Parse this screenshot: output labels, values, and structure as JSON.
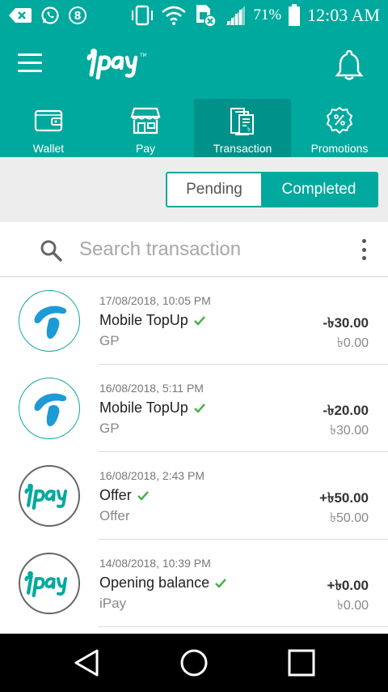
{
  "status_bar": {
    "battery_percent": "71%",
    "time": "12:03 AM"
  },
  "app": {
    "logo_text": "ipay"
  },
  "tabs": [
    {
      "label": "Wallet",
      "icon": "wallet-icon",
      "active": false
    },
    {
      "label": "Pay",
      "icon": "store-icon",
      "active": false
    },
    {
      "label": "Transaction",
      "icon": "receipt-icon",
      "active": true
    },
    {
      "label": "Promotions",
      "icon": "discount-badge-icon",
      "active": false
    }
  ],
  "filter": {
    "pending_label": "Pending",
    "completed_label": "Completed",
    "selected": "Completed"
  },
  "search": {
    "placeholder": "Search transaction"
  },
  "transactions": [
    {
      "date": "17/08/2018, 10:05 PM",
      "title": "Mobile TopUp",
      "subtitle": "GP",
      "amount": "-৳30.00",
      "balance": "৳0.00",
      "avatar": "gp-logo",
      "status": "completed"
    },
    {
      "date": "16/08/2018, 5:11 PM",
      "title": "Mobile TopUp",
      "subtitle": "GP",
      "amount": "-৳20.00",
      "balance": "৳30.00",
      "avatar": "gp-logo",
      "status": "completed"
    },
    {
      "date": "16/08/2018, 2:43 PM",
      "title": "Offer",
      "subtitle": "Offer",
      "amount": "+৳50.00",
      "balance": "৳50.00",
      "avatar": "ipay-logo",
      "status": "completed"
    },
    {
      "date": "14/08/2018, 10:39 PM",
      "title": "Opening balance",
      "subtitle": "iPay",
      "amount": "+৳0.00",
      "balance": "৳0.00",
      "avatar": "ipay-logo",
      "status": "completed"
    }
  ],
  "colors": {
    "brand": "#00a99d",
    "brand_dark": "#00928a",
    "check_green": "#4caf50",
    "gp_blue": "#1e9ad6"
  }
}
